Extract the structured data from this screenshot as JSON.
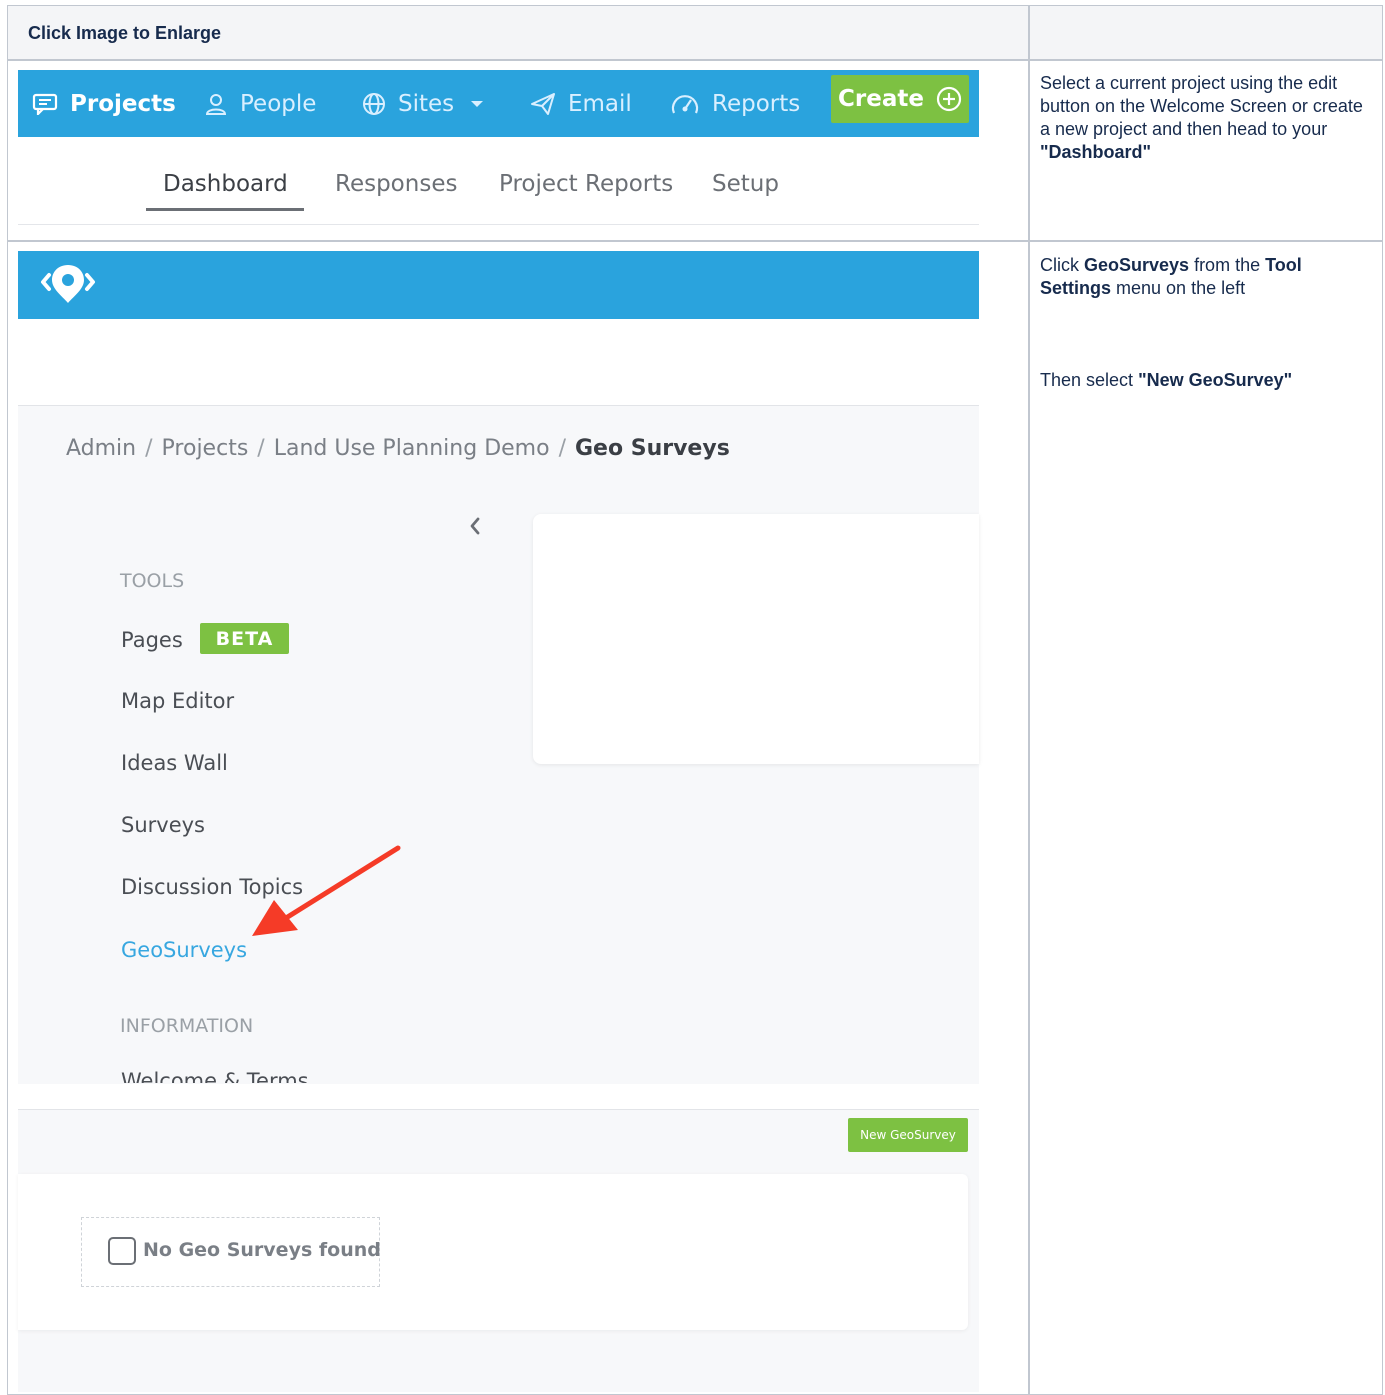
{
  "header": {
    "title": "Click Image to Enlarge"
  },
  "rows": [
    {
      "desc_html": "Select a current project using the edit button on the Welcome Screen or create a new project and then head to your <b>\"Dashboard\"</b>"
    },
    {
      "desc_html": "Click <b>GeoSurveys</b> from the <b>Tool Settings</b> menu on the left",
      "desc2_html": "Then select <b>\"New GeoSurvey\"</b>"
    }
  ],
  "nav": {
    "items": [
      {
        "label": "Projects",
        "icon": "chat-icon",
        "active": true
      },
      {
        "label": "People",
        "icon": "person-icon"
      },
      {
        "label": "Sites",
        "icon": "globe-icon"
      },
      {
        "label": "Email",
        "icon": "paper-plane-icon"
      },
      {
        "label": "Reports",
        "icon": "speedometer-icon"
      }
    ],
    "create_label": "Create"
  },
  "subtabs": [
    "Dashboard",
    "Responses",
    "Project Reports",
    "Setup"
  ],
  "breadcrumb": [
    "Admin",
    "Projects",
    "Land Use Planning Demo",
    "Geo Surveys"
  ],
  "menu": {
    "tools_heading": "TOOLS",
    "items": [
      "Pages",
      "Map Editor",
      "Ideas Wall",
      "Surveys",
      "Discussion Topics",
      "GeoSurveys"
    ],
    "beta_label": "BETA",
    "info_heading": "INFORMATION",
    "info_items": [
      "Welcome & Terms"
    ]
  },
  "geosurveys": {
    "new_button": "New GeoSurvey",
    "empty_text": "No Geo Surveys found"
  },
  "colors": {
    "brand_blue": "#2aa3dd",
    "accent_green": "#7dc142",
    "arrow_red": "#f53b27",
    "active_link": "#37a7e0"
  }
}
